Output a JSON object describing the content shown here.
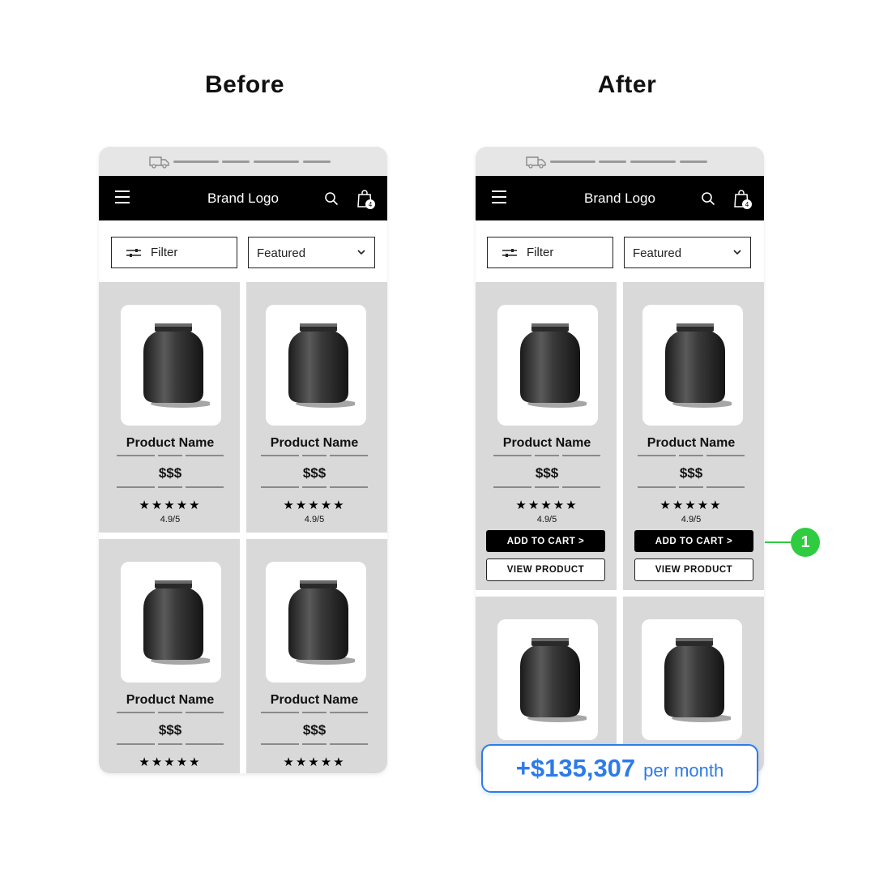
{
  "labels": {
    "before": "Before",
    "after": "After"
  },
  "phone": {
    "brand": "Brand Logo",
    "cart_count": "4",
    "filter_label": "Filter",
    "sort_value": "Featured"
  },
  "product": {
    "name": "Product Name",
    "price": "$$$",
    "stars": "★★★★★",
    "rating": "4.9/5",
    "add_to_cart": "ADD TO CART >",
    "view_product": "VIEW PRODUCT"
  },
  "callout": {
    "number": "1"
  },
  "revenue": {
    "amount": "+$135,307",
    "period": "per month"
  },
  "colors": {
    "accent_blue": "#2e7be8",
    "accent_green": "#2ecc40",
    "nav_bg": "#000000",
    "card_bg": "#d9d9d9"
  },
  "icons": [
    "truck-icon",
    "hamburger-icon",
    "search-icon",
    "shopping-bag-icon",
    "filter-sliders-icon",
    "chevron-down-icon",
    "product-jar-image"
  ]
}
